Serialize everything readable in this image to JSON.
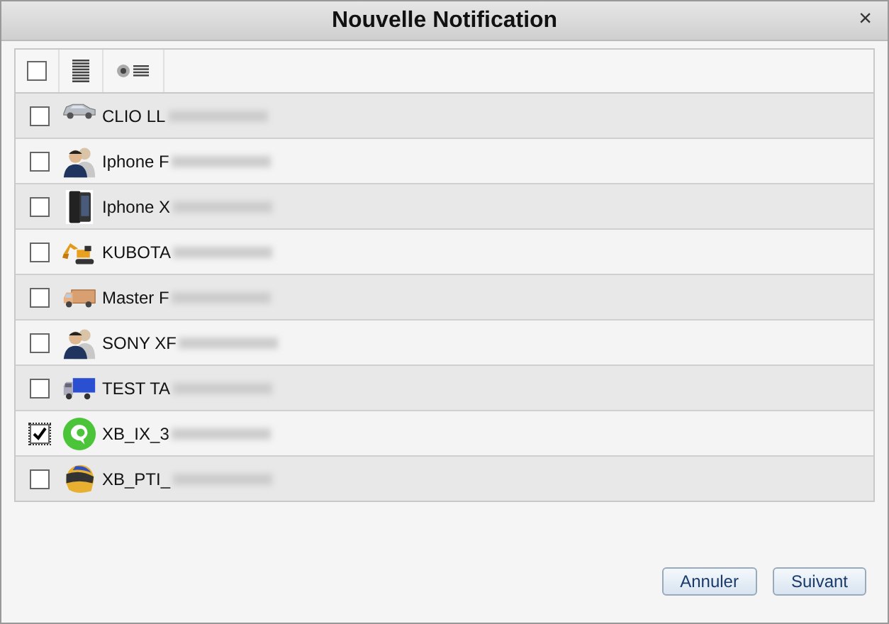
{
  "window": {
    "title": "Nouvelle Notification",
    "close": "×"
  },
  "toolbar": {
    "select_all": {
      "checked": false
    }
  },
  "rows": [
    {
      "label": "CLIO LL",
      "kind": "car",
      "checked": false
    },
    {
      "label": "Iphone F",
      "kind": "people",
      "checked": false
    },
    {
      "label": "Iphone X",
      "kind": "phone",
      "checked": false
    },
    {
      "label": "KUBOTA",
      "kind": "excavator",
      "checked": false
    },
    {
      "label": "Master F",
      "kind": "van",
      "checked": false
    },
    {
      "label": "SONY XF",
      "kind": "people",
      "checked": false
    },
    {
      "label": "TEST TA",
      "kind": "lorry",
      "checked": false
    },
    {
      "label": "XB_IX_3",
      "kind": "chat",
      "checked": true
    },
    {
      "label": "XB_PTI_",
      "kind": "helmet",
      "checked": false
    }
  ],
  "buttons": [
    "Annuler",
    "Suivant"
  ]
}
